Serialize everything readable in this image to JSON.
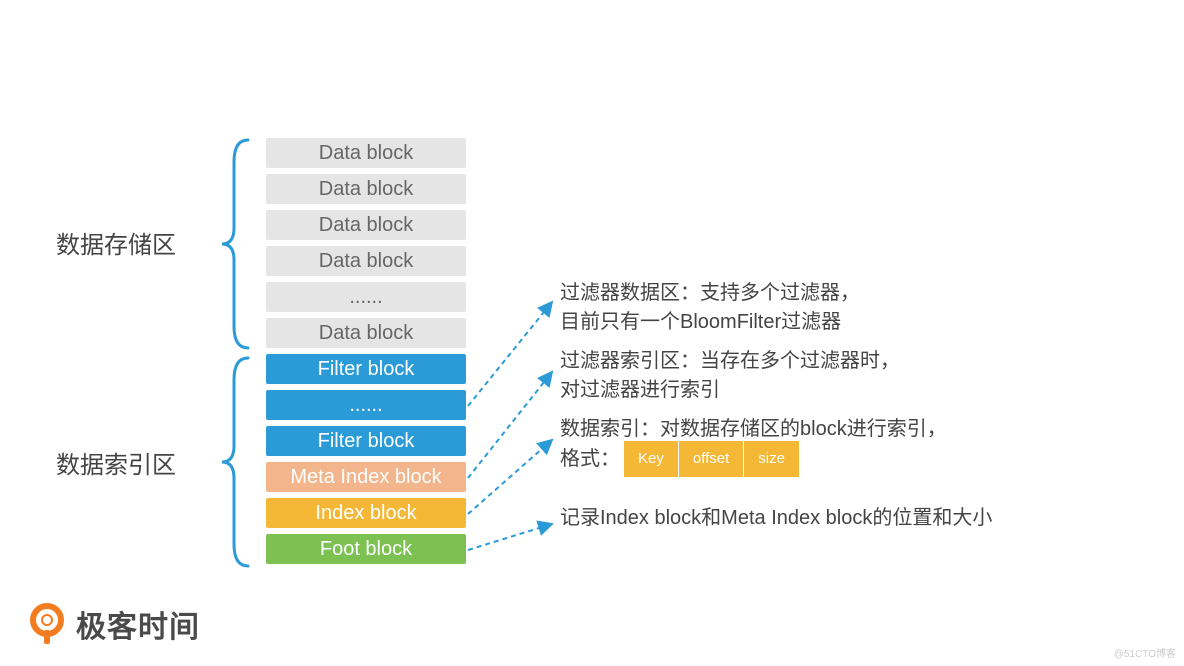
{
  "regions": {
    "storage_label": "数据存储区",
    "index_label": "数据索引区"
  },
  "stack": {
    "data_blocks": [
      "Data block",
      "Data block",
      "Data block",
      "Data block",
      "......",
      "Data block"
    ],
    "filter_blocks": [
      "Filter block",
      "......",
      "Filter block"
    ],
    "meta_index": "Meta Index block",
    "index": "Index block",
    "foot": "Foot block"
  },
  "annotations": {
    "filter_data_l1": "过滤器数据区：支持多个过滤器，",
    "filter_data_l2": "目前只有一个BloomFilter过滤器",
    "filter_index_l1": "过滤器索引区：当存在多个过滤器时，",
    "filter_index_l2": "对过滤器进行索引",
    "data_index_l1": "数据索引：对数据存储区的block进行索引，",
    "data_index_l2": "格式：",
    "key_fields": [
      "Key",
      "offset",
      "size"
    ],
    "foot_note": "记录Index block和Meta Index block的位置和大小"
  },
  "branding": {
    "name": "极客时间",
    "watermark": "@51CTO博客"
  },
  "colors": {
    "data": "#e5e5e5",
    "filter": "#2b9bd8",
    "meta": "#f2b58c",
    "index": "#f4b836",
    "foot": "#7cc152",
    "accent": "#f47c20",
    "arrow": "#2b9bd8"
  }
}
